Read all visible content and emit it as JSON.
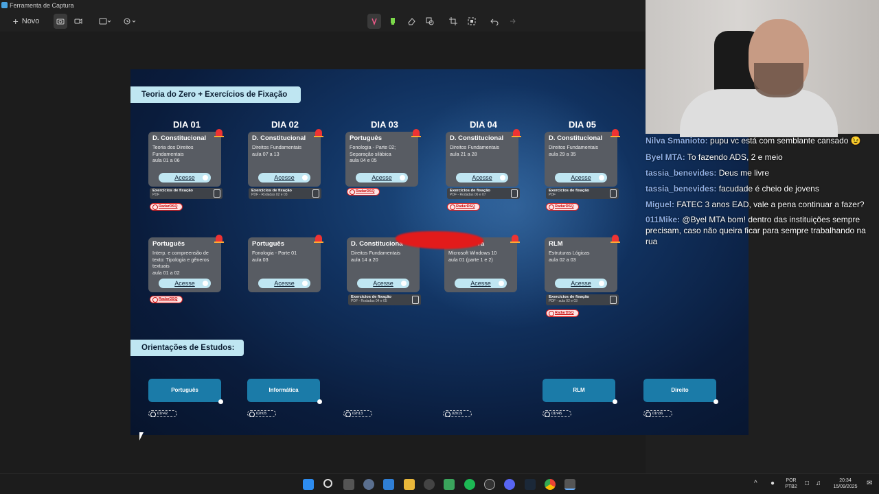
{
  "window": {
    "title": "Ferramenta de Captura"
  },
  "toolbar": {
    "new_label": "Novo"
  },
  "slide": {
    "banner_top": "Teoria do Zero + Exercícios de Fixação",
    "banner_bottom": "Orientações de Estudos:",
    "days": [
      "DIA 01",
      "DIA 02",
      "DIA 03",
      "DIA 04",
      "DIA 05"
    ],
    "access_label": "Acesse",
    "exercise_title": "Exercícios de fixação",
    "radar_label": "RadarDSQ",
    "row1": [
      {
        "title": "D. Constitucional",
        "desc": "Teoria dos Direitos\nFundamentais\naula 01 a 06"
      },
      {
        "title": "D. Constitucional",
        "desc": "Direitos Fundamentais\naula 07 a 13"
      },
      {
        "title": "Português",
        "desc": "Fonologia - Parte 02;\nSeparação silábica\naula 04 e 05"
      },
      {
        "title": "D. Constitucional",
        "desc": "Direitos Fundamentais\naula 21 a 28"
      },
      {
        "title": "D. Constitucional",
        "desc": "Direitos Fundamentais\naula 29 a 35"
      }
    ],
    "row1_ex": [
      "PDF",
      "PDF - Rodadas 02 e 03",
      "",
      "PDF - Rodadas 06 e 07",
      "PDF"
    ],
    "row2": [
      {
        "title": "Português",
        "desc": "Interp. e compreensão de\ntexto: Tipologia e gêneros\ntextuais\naula 01 a 02"
      },
      {
        "title": "Português",
        "desc": "Fonologia - Parte 01\naula 03"
      },
      {
        "title": "D. Constituciona",
        "desc": "Direitos Fundamentais\naula 14 a 20"
      },
      {
        "title": "ra",
        "desc": "Microsoft Windows 10\naula 01 (parte 1 e 2)"
      },
      {
        "title": "RLM",
        "desc": "Estruturas Lógicas\naula 02 a 03"
      }
    ],
    "row2_ex": [
      "PDF - Rodadas 04 e 05",
      "PDF - aula 02 e 03"
    ],
    "subjects": [
      "Português",
      "Informática",
      "RLM",
      "Direito"
    ],
    "timers": [
      "01h42",
      "02h05",
      "02h13",
      "02h19",
      "01h45",
      "01h36"
    ]
  },
  "chat": [
    {
      "user": "Nilva Smanioto:",
      "text": "pupu vc está com semblante cansado 😉"
    },
    {
      "user": "Byel MTA:",
      "text": "To fazendo ADS, 2 e meio"
    },
    {
      "user": "tassia_benevides:",
      "text": "Deus me livre"
    },
    {
      "user": "tassia_benevides:",
      "text": "facudade é cheio de jovens"
    },
    {
      "user": "Miguel:",
      "text": "FATEC 3 anos EAD, vale a pena continuar a fazer?"
    },
    {
      "user": "011Mike:",
      "text": "@Byel MTA bom! dentro das instituições sempre precisam, caso não queira ficar para sempre trabalhando na rua"
    }
  ],
  "tray": {
    "lang1": "POR",
    "lang2": "PTB2",
    "time": "20:34",
    "date": "15/09/2025"
  },
  "colors": {
    "accent": "#1b7ba8",
    "banner": "#bfe6f2",
    "card": "#585c63",
    "radar": "#d22222"
  }
}
